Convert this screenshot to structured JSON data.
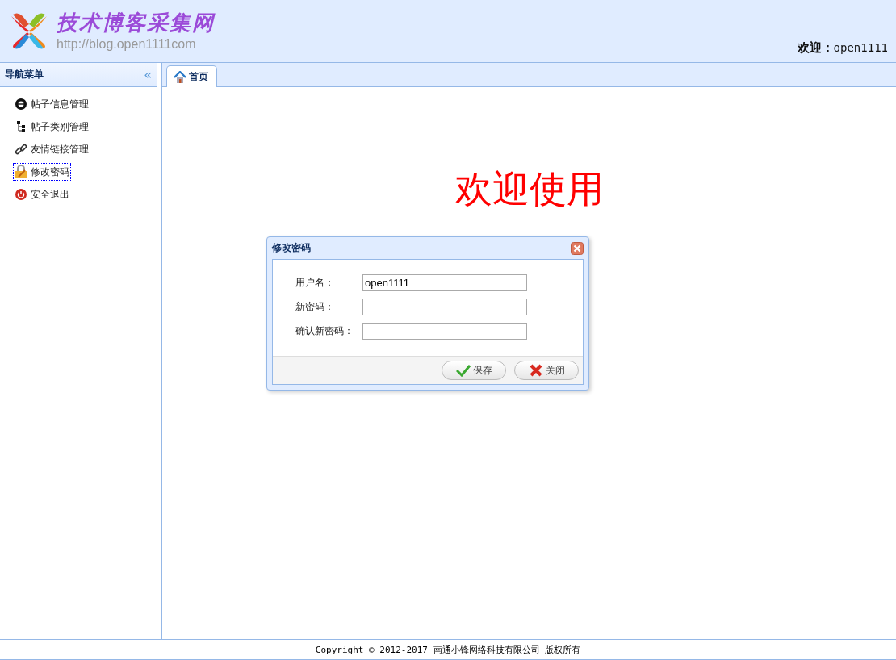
{
  "header": {
    "site_title": "技术博客采集网",
    "site_url": "http://blog.open1111com",
    "welcome_label": "欢迎：",
    "username": "open1111"
  },
  "sidebar": {
    "title": "导航菜单",
    "collapse_glyph": "«",
    "items": [
      {
        "label": "帖子信息管理",
        "selected": false
      },
      {
        "label": "帖子类别管理",
        "selected": false
      },
      {
        "label": "友情链接管理",
        "selected": false
      },
      {
        "label": "修改密码",
        "selected": true
      },
      {
        "label": "安全退出",
        "selected": false
      }
    ]
  },
  "tabs": [
    {
      "label": "首页",
      "selected": true
    }
  ],
  "main": {
    "welcome_text": "欢迎使用"
  },
  "dialog": {
    "title": "修改密码",
    "fields": [
      {
        "label": "用户名：",
        "value": "open1111"
      },
      {
        "label": "新密码："
      },
      {
        "label": "确认新密码："
      }
    ],
    "buttons": [
      {
        "label": "保存",
        "kind": "save"
      },
      {
        "label": "关闭",
        "kind": "close"
      }
    ]
  },
  "footer": {
    "copyright": "Copyright © 2012-2017 南通小锋网络科技有限公司 版权所有"
  }
}
